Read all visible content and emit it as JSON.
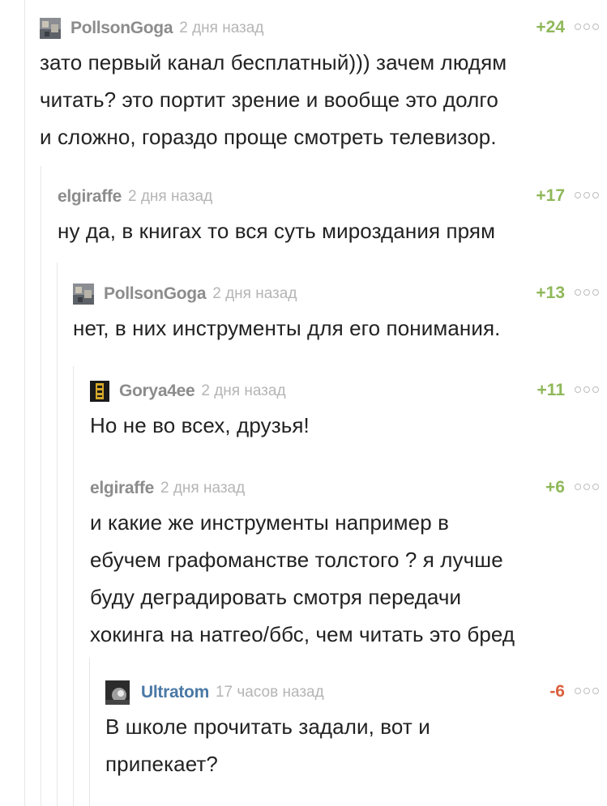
{
  "comments": [
    {
      "author": "PollsonGoga",
      "time": "2 дня назад",
      "rating": "+24",
      "text_lines": [
        "зато первый канал бесплатный))) зачем людям",
        "читать? это портит зрение и вообще это долго",
        "и сложно, гораздо проще смотреть телевизор."
      ]
    },
    {
      "author": "elgiraffe",
      "time": "2 дня назад",
      "rating": "+17",
      "text_lines": [
        "ну да, в книгах то вся суть мироздания прям"
      ]
    },
    {
      "author": "PollsonGoga",
      "time": "2 дня назад",
      "rating": "+13",
      "text_lines": [
        "нет, в них инструменты для его понимания."
      ]
    },
    {
      "author": "Gorya4ee",
      "time": "2 дня назад",
      "rating": "+11",
      "text_lines": [
        "Но не во всех, друзья!"
      ]
    },
    {
      "author": "elgiraffe",
      "time": "2 дня назад",
      "rating": "+6",
      "text_lines": [
        "и какие же инструменты например в",
        "ебучем графоманстве толстого ? я лучше",
        "буду деградировать смотря передачи",
        "хокинга на натгео/ббс, чем читать это бред"
      ]
    },
    {
      "author": "Ultratom",
      "time": "17 часов назад",
      "rating": "-6",
      "text_lines": [
        "В школе прочитать задали, вот и",
        "припекает?"
      ]
    }
  ],
  "colors": {
    "positive_rating": "#8fb85a",
    "negative_rating": "#d9603b",
    "author": "#8c8c8c",
    "highlighted_author": "#4a79a6"
  }
}
